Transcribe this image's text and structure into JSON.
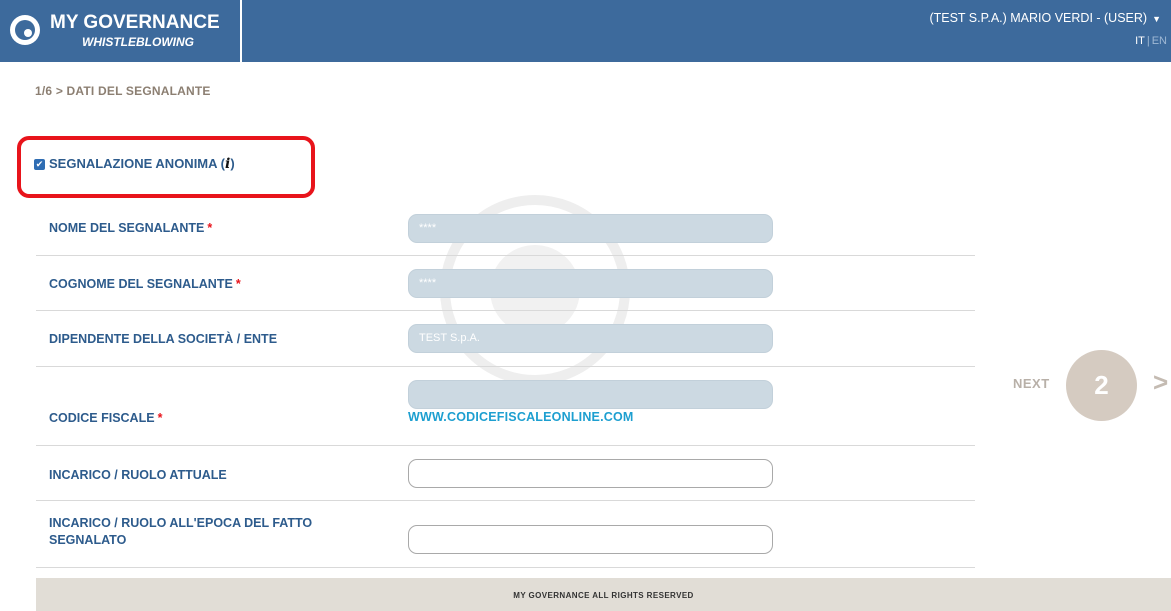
{
  "header": {
    "app_title": "MY GOVERNANCE",
    "app_subtitle": "WHISTLEBLOWING",
    "user_label": "(TEST S.P.A.) MARIO VERDI - (USER)",
    "caret": "▼",
    "lang_it": "IT",
    "lang_sep": "|",
    "lang_en": "EN"
  },
  "breadcrumb": "1/6 > DATI DEL SEGNALANTE",
  "anonymous": {
    "label": "SEGNALAZIONE ANONIMA (",
    "info": "i",
    "close": ")",
    "checked": true,
    "check_glyph": "✔"
  },
  "fields": [
    {
      "label": "NOME DEL SEGNALANTE",
      "required": true,
      "value": "****",
      "disabled": true
    },
    {
      "label": "COGNOME DEL SEGNALANTE",
      "required": true,
      "value": "****",
      "disabled": true
    },
    {
      "label": "DIPENDENTE DELLA SOCIETÀ / ENTE",
      "required": false,
      "value": "TEST S.p.A.",
      "disabled": true
    },
    {
      "label": "CODICE FISCALE",
      "required": true,
      "value": "",
      "disabled": true,
      "link": "WWW.CODICEFISCALEONLINE.COM"
    },
    {
      "label": "INCARICO / RUOLO ATTUALE",
      "required": false,
      "value": "",
      "disabled": false
    },
    {
      "label_line1": "INCARICO / RUOLO ALL'EPOCA DEL FATTO",
      "label_line2": "SEGNALATO",
      "required": false,
      "value": "",
      "disabled": false
    }
  ],
  "required_mark": "*",
  "next": {
    "label": "NEXT",
    "step": "2",
    "arrow": ">"
  },
  "footer": "MY GOVERNANCE ALL RIGHTS RESERVED",
  "colors": {
    "header_bg": "#3d6a9c",
    "label": "#2d5b8c",
    "required": "#e8141b",
    "link": "#1d9fd0",
    "highlight": "#e8141b"
  }
}
